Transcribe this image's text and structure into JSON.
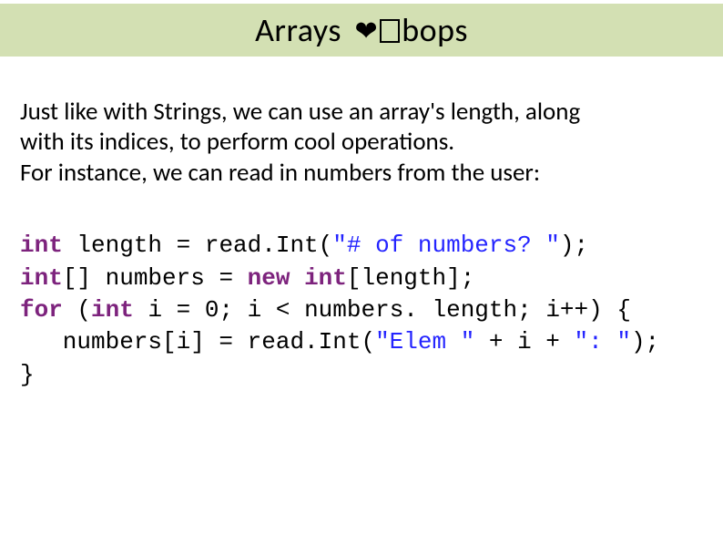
{
  "title": {
    "left": "Arrays ",
    "right": "bops"
  },
  "paragraph": {
    "line1": "Just like with Strings, we can use an array's length, along",
    "line2": "with its indices, to perform cool operations.",
    "line3": "For instance, we can read in numbers from the user:"
  },
  "code": {
    "kw_int1": "int",
    "l1a": " length = read.Int(",
    "l1s": "\"# of numbers? \"",
    "l1b": ");",
    "kw_int2": "int",
    "l2a": "[] numbers = ",
    "kw_new": "new",
    "l2b": " ",
    "kw_int3": "int",
    "l2c": "[length];",
    "kw_for": "for",
    "l3a": " (",
    "kw_int4": "int",
    "l3b": " i = 0; i < numbers. length; i++) {",
    "l4a": "   numbers[i] = read.Int(",
    "l4s1": "\"Elem \"",
    "l4b": " + i + ",
    "l4s2": "\": \"",
    "l4c": ");",
    "l5": "}"
  }
}
